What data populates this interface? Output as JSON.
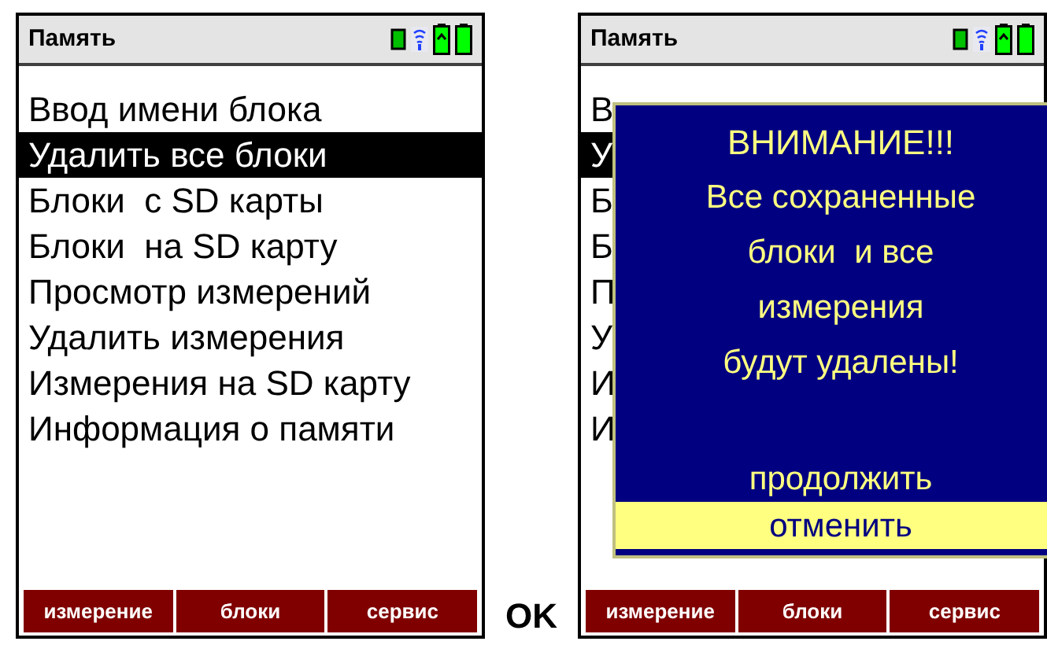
{
  "screens": [
    {
      "title": "Память",
      "menu": [
        {
          "label": "Ввод имени блока",
          "selected": false
        },
        {
          "label": "Удалить все блоки",
          "selected": true
        },
        {
          "label": "Блоки  с SD карты",
          "selected": false
        },
        {
          "label": "Блоки  на SD карту",
          "selected": false
        },
        {
          "label": "Просмотр измерений",
          "selected": false
        },
        {
          "label": "Удалить измерения",
          "selected": false
        },
        {
          "label": "Измерения на SD карту",
          "selected": false
        },
        {
          "label": "Информация о памяти",
          "selected": false
        }
      ],
      "softkeys": [
        "измерение",
        "блоки",
        "сервис"
      ]
    },
    {
      "title": "Память",
      "menu": [
        {
          "label": "В",
          "selected": false
        },
        {
          "label": "У",
          "selected": true
        },
        {
          "label": "Б",
          "selected": false
        },
        {
          "label": "Б",
          "selected": false
        },
        {
          "label": "П",
          "selected": false
        },
        {
          "label": "У",
          "selected": false
        },
        {
          "label": "И",
          "selected": false
        },
        {
          "label": "И",
          "selected": false
        }
      ],
      "softkeys": [
        "измерение",
        "блоки",
        "сервис"
      ],
      "dialog": {
        "heading": "ВНИМАНИЕ!!!",
        "lines": [
          "Все сохраненные",
          "блоки  и все",
          "измерения",
          "будут удалены!"
        ],
        "options": [
          {
            "label": "продолжить",
            "selected": false
          },
          {
            "label": "отменить",
            "selected": true
          }
        ]
      }
    }
  ],
  "key_label": "OK"
}
